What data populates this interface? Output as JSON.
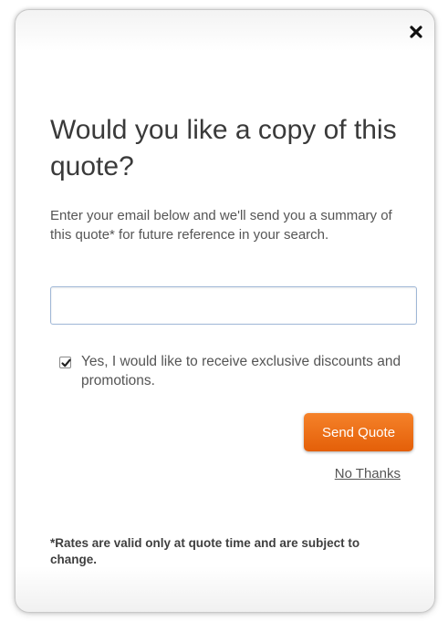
{
  "modal": {
    "close_icon": "close-icon",
    "title": "Would you like a copy of this quote?",
    "description": "Enter your email below and we'll send you a summary of this quote* for future reference in your search.",
    "email": {
      "value": "",
      "placeholder": ""
    },
    "optin": {
      "checked": true,
      "label": "Yes, I would like to receive exclusive discounts and promotions."
    },
    "send_button_label": "Send Quote",
    "no_thanks_label": "No Thanks",
    "footnote": "*Rates are valid only at quote time and are subject to change."
  },
  "colors": {
    "accent": "#ee6f14",
    "input_border": "#9fb7d6",
    "text": "#555555"
  }
}
